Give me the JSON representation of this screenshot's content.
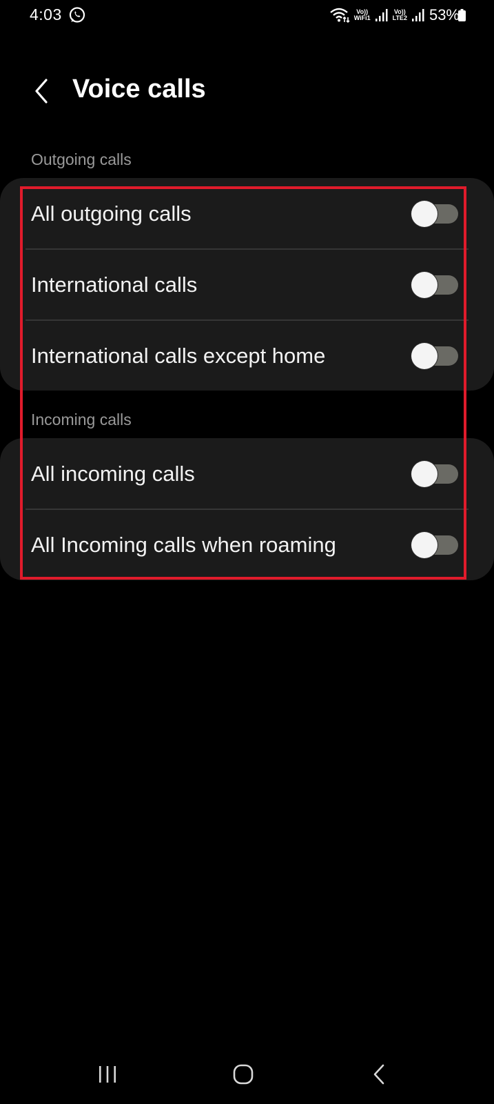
{
  "status_bar": {
    "time": "4:03",
    "volte_top": "Vo))",
    "volte_wifi_bottom": "WiFi1",
    "volte_lte_bottom": "LTE2",
    "battery_percent": "53%",
    "icons": [
      "whatsapp-icon",
      "wifi-icon",
      "signal-icon",
      "battery-icon"
    ]
  },
  "header": {
    "title": "Voice calls",
    "back_icon": "chevron-left-icon"
  },
  "sections": [
    {
      "label": "Outgoing calls",
      "items": [
        {
          "label": "All outgoing calls",
          "enabled": false
        },
        {
          "label": "International calls",
          "enabled": false
        },
        {
          "label": "International calls except home",
          "enabled": false
        }
      ]
    },
    {
      "label": "Incoming calls",
      "items": [
        {
          "label": "All incoming calls",
          "enabled": false
        },
        {
          "label": "All Incoming calls when roaming",
          "enabled": false
        }
      ]
    }
  ],
  "nav_bar": {
    "icons": [
      "recent-apps-icon",
      "home-icon",
      "back-icon"
    ]
  },
  "colors": {
    "background": "#000000",
    "card": "#1b1b1b",
    "section_label": "#9a9a9a",
    "toggle_track_off": "#6a6a64",
    "toggle_thumb": "#f4f4f4",
    "highlight": "#e01b2b"
  }
}
